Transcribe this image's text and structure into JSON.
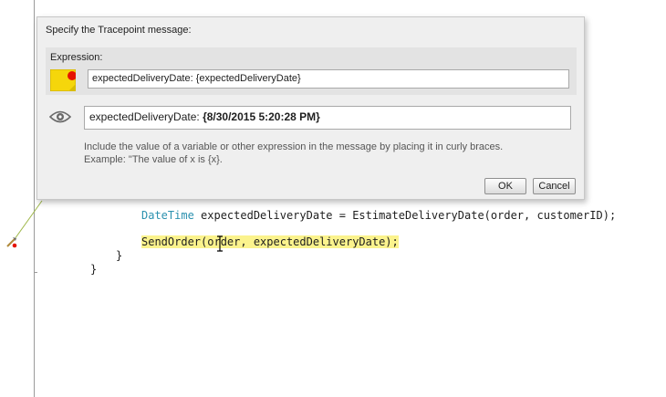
{
  "dialog": {
    "title": "Specify the Tracepoint message:",
    "expression_label": "Expression:",
    "expression_value": "expectedDeliveryDate: {expectedDeliveryDate}",
    "result_prefix": "expectedDeliveryDate: ",
    "result_value": "{8/30/2015 5:20:28 PM}",
    "help_line1": "Include the value of a variable or other expression in the message by placing it in curly braces.",
    "help_line2": "Example: \"The value of x is {x}.",
    "ok_label": "OK",
    "cancel_label": "Cancel"
  },
  "code": {
    "line1_type": "DateTime",
    "line1_rest": " expectedDeliveryDate = EstimateDeliveryDate(order, customerID);",
    "line2": "SendOrder(order, expectedDeliveryDate);",
    "line3": "}",
    "line4": "}"
  },
  "colors": {
    "highlight": "#fbf38d",
    "type_keyword": "#2b91af",
    "tracepoint_marker": "#e51400"
  },
  "icons": {
    "expression": "tracepoint-note-icon",
    "result": "eye-icon",
    "gutter": "tracepoint-icon"
  }
}
